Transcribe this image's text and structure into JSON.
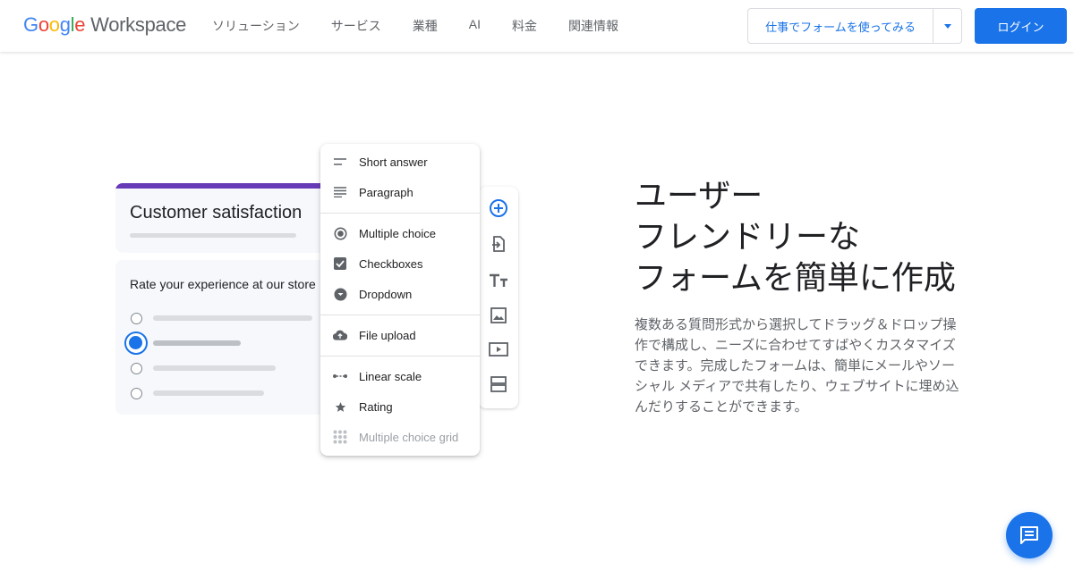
{
  "header": {
    "logo_google": [
      "G",
      "o",
      "o",
      "g",
      "l",
      "e"
    ],
    "logo_workspace": "Workspace",
    "nav": [
      "ソリューション",
      "サービス",
      "業種",
      "AI",
      "料金",
      "関連情報"
    ],
    "cta_label": "仕事でフォームを使ってみる",
    "login_label": "ログイン"
  },
  "illustration": {
    "form_title": "Customer satisfaction",
    "question": "Rate your experience at our store",
    "options_count": 4,
    "selected_option_index": 1
  },
  "question_type_menu": {
    "groups": [
      [
        {
          "label": "Short answer",
          "icon": "short-answer-icon"
        },
        {
          "label": "Paragraph",
          "icon": "paragraph-icon"
        }
      ],
      [
        {
          "label": "Multiple choice",
          "icon": "radio-button-icon"
        },
        {
          "label": "Checkboxes",
          "icon": "checkbox-icon"
        },
        {
          "label": "Dropdown",
          "icon": "dropdown-icon"
        }
      ],
      [
        {
          "label": "File upload",
          "icon": "cloud-upload-icon"
        }
      ],
      [
        {
          "label": "Linear scale",
          "icon": "linear-scale-icon"
        },
        {
          "label": "Rating",
          "icon": "star-icon"
        },
        {
          "label": "Multiple choice grid",
          "icon": "grid-icon",
          "disabled": true
        }
      ]
    ]
  },
  "toolbar_icons": [
    "add-question-icon",
    "import-questions-icon",
    "add-title-icon",
    "add-image-icon",
    "add-video-icon",
    "add-section-icon"
  ],
  "hero": {
    "headline_lines": [
      "ユーザー",
      "フレンドリーな",
      "フォームを簡単に作成"
    ],
    "description": "複数ある質問形式から選択してドラッグ＆ドロップ操作で構成し、ニーズに合わせてすばやくカスタマイズできます。完成したフォームは、簡単にメールやソーシャル メディアで共有したり、ウェブサイトに埋め込んだりすることができます。"
  },
  "colors": {
    "accent": "#1a73e8",
    "form_header": "#673ab7"
  }
}
